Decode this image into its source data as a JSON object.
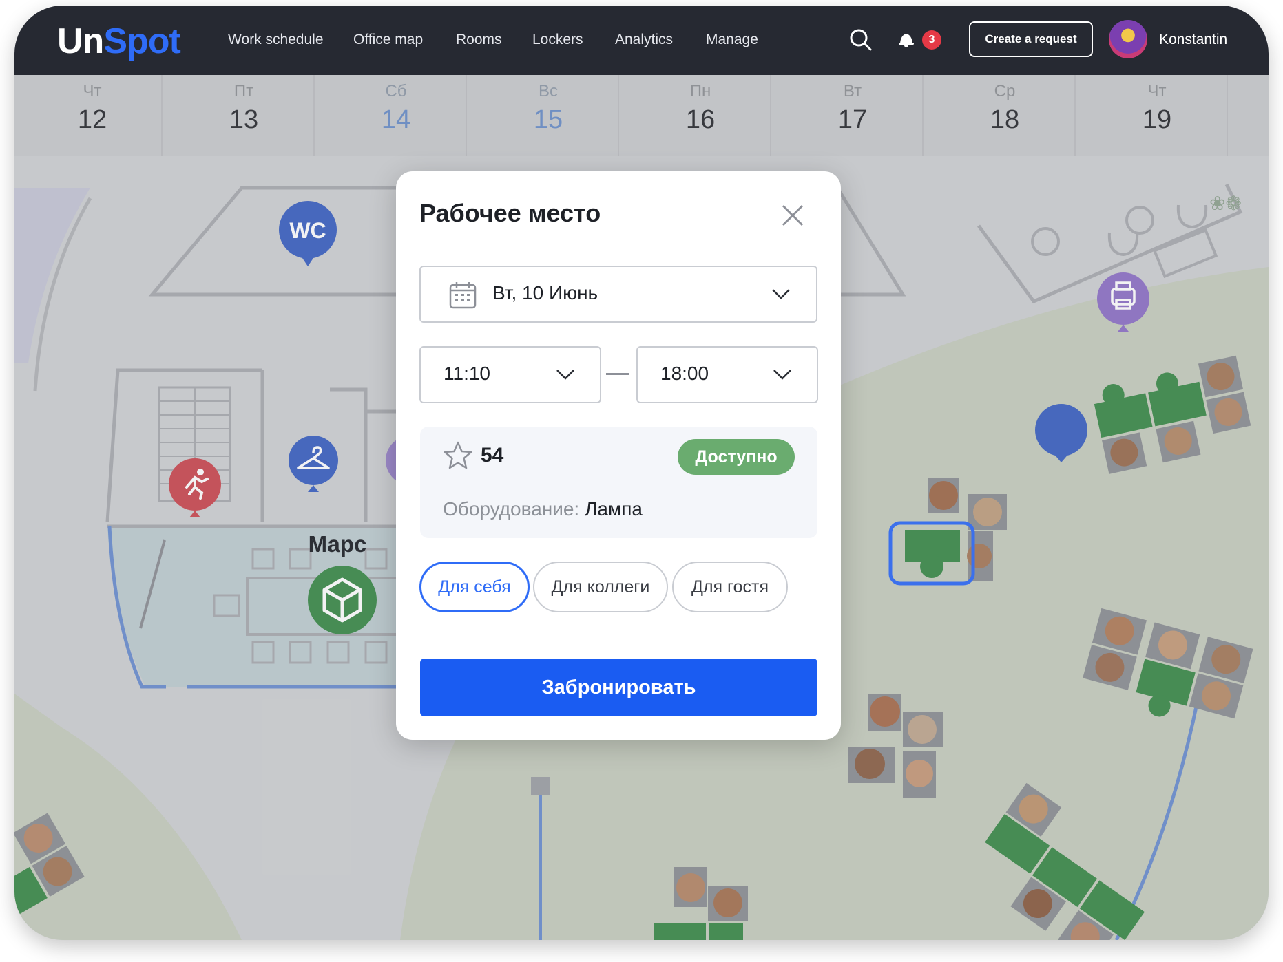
{
  "app": {
    "logo_part1": "Un",
    "logo_part2": "Spot",
    "brand_color": "#2f6cf7"
  },
  "nav": {
    "items": [
      "Work schedule",
      "Office map",
      "Rooms",
      "Lockers",
      "Analytics",
      "Manage"
    ]
  },
  "header": {
    "search_icon": "search-icon",
    "notifications_icon": "bell-icon",
    "notifications_count": "3",
    "create_request_label": "Create a request",
    "user_name": "Konstantin"
  },
  "dates": [
    {
      "weekday": "Чт",
      "day": "12"
    },
    {
      "weekday": "Пт",
      "day": "13"
    },
    {
      "weekday": "Сб",
      "day": "14"
    },
    {
      "weekday": "Вс",
      "day": "15"
    },
    {
      "weekday": "Пн",
      "day": "16"
    },
    {
      "weekday": "Вт",
      "day": "17"
    },
    {
      "weekday": "Ср",
      "day": "18"
    },
    {
      "weekday": "Чт",
      "day": "19"
    }
  ],
  "map": {
    "wc_label": "WC",
    "room_label": "Марс"
  },
  "modal": {
    "title": "Рабочее место",
    "date_value": "Вт, 10 Июнь",
    "time_from": "11:10",
    "time_to": "18:00",
    "seat_number": "54",
    "status": "Доступно",
    "equipment_label": "Оборудование:",
    "equipment_value": "Лампа",
    "for_self": "Для себя",
    "for_colleague": "Для коллеги",
    "for_guest": "Для гостя",
    "book_button": "Забронировать",
    "status_color": "#6aac6f",
    "button_color": "#1a5cf2"
  }
}
